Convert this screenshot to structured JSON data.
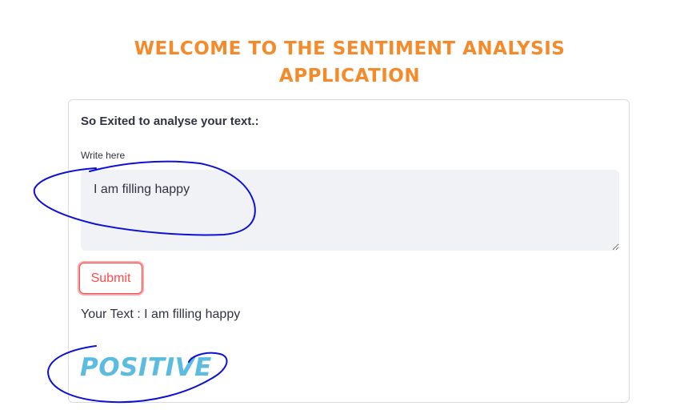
{
  "header": {
    "title_line1": "WELCOME TO THE SENTIMENT ANALYSIS",
    "title_line2": "APPLICATION"
  },
  "form": {
    "heading": "So Exited to analyse your text.:",
    "input_label": "Write here",
    "input_value": "I am filling happy",
    "submit_label": "Submit"
  },
  "result": {
    "text_line": "Your Text : I am filling happy",
    "sentiment": "POSITIVE"
  },
  "colors": {
    "title": "#f58a2a",
    "accent": "#ff4b4b",
    "sentiment": "#5bbce0",
    "annotation": "#0d11d6"
  }
}
